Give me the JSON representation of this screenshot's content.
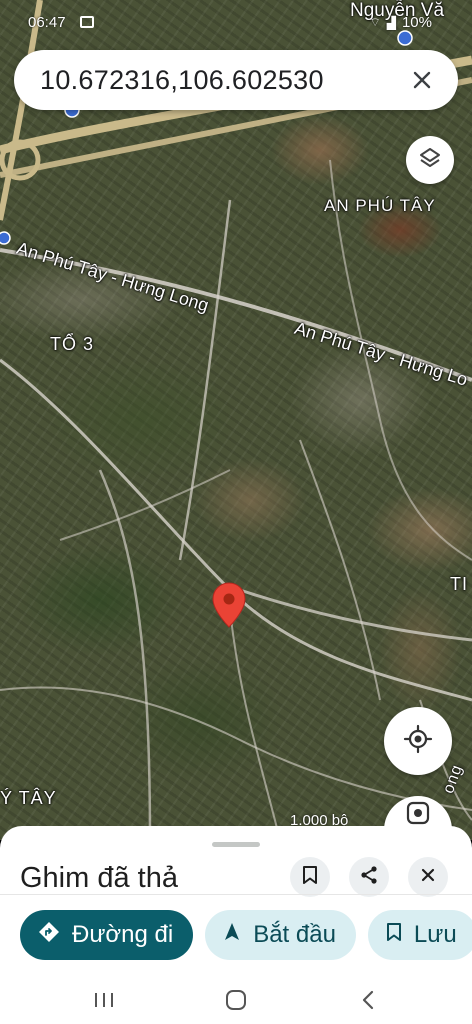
{
  "status_bar": {
    "time": "06:47",
    "battery": "10%",
    "notification_icon": "image-icon",
    "signal_icons": [
      "wifi-icon",
      "signal-icon",
      "battery-icon"
    ]
  },
  "search": {
    "query": "10.672316,106.602530",
    "close_icon": "close-icon"
  },
  "map": {
    "labels": {
      "place_top_right": "Nguyễn Vă",
      "district": "AN PHÚ TÂY",
      "road_1": "An Phú Tây - Hưng Long",
      "road_2": "An Phú Tây - Hưng Lo",
      "neighborhood": "TỔ 3",
      "edge_right": "TI",
      "edge_bottom_left": "Ý TÂY",
      "edge_bottom_right": "ong"
    },
    "scale_text": "1.000 bộ",
    "layers_icon": "layers-icon",
    "location_icon": "my-location-icon",
    "pin_icon": "map-pin-icon"
  },
  "sheet": {
    "title": "Ghim đã thả",
    "save_icon": "bookmark-icon",
    "share_icon": "share-icon",
    "close_icon": "close-icon",
    "actions": [
      {
        "label": "Đường đi",
        "icon": "directions-icon"
      },
      {
        "label": "Bắt đầu",
        "icon": "navigation-icon"
      },
      {
        "label": "Lưu",
        "icon": "bookmark-icon"
      }
    ]
  },
  "navbar": {
    "recent": "recent-apps-icon",
    "home": "home-icon",
    "back": "back-icon"
  },
  "colors": {
    "primary": "#0b5e6b",
    "secondary": "#d9eef2",
    "pin": "#ea4335"
  }
}
